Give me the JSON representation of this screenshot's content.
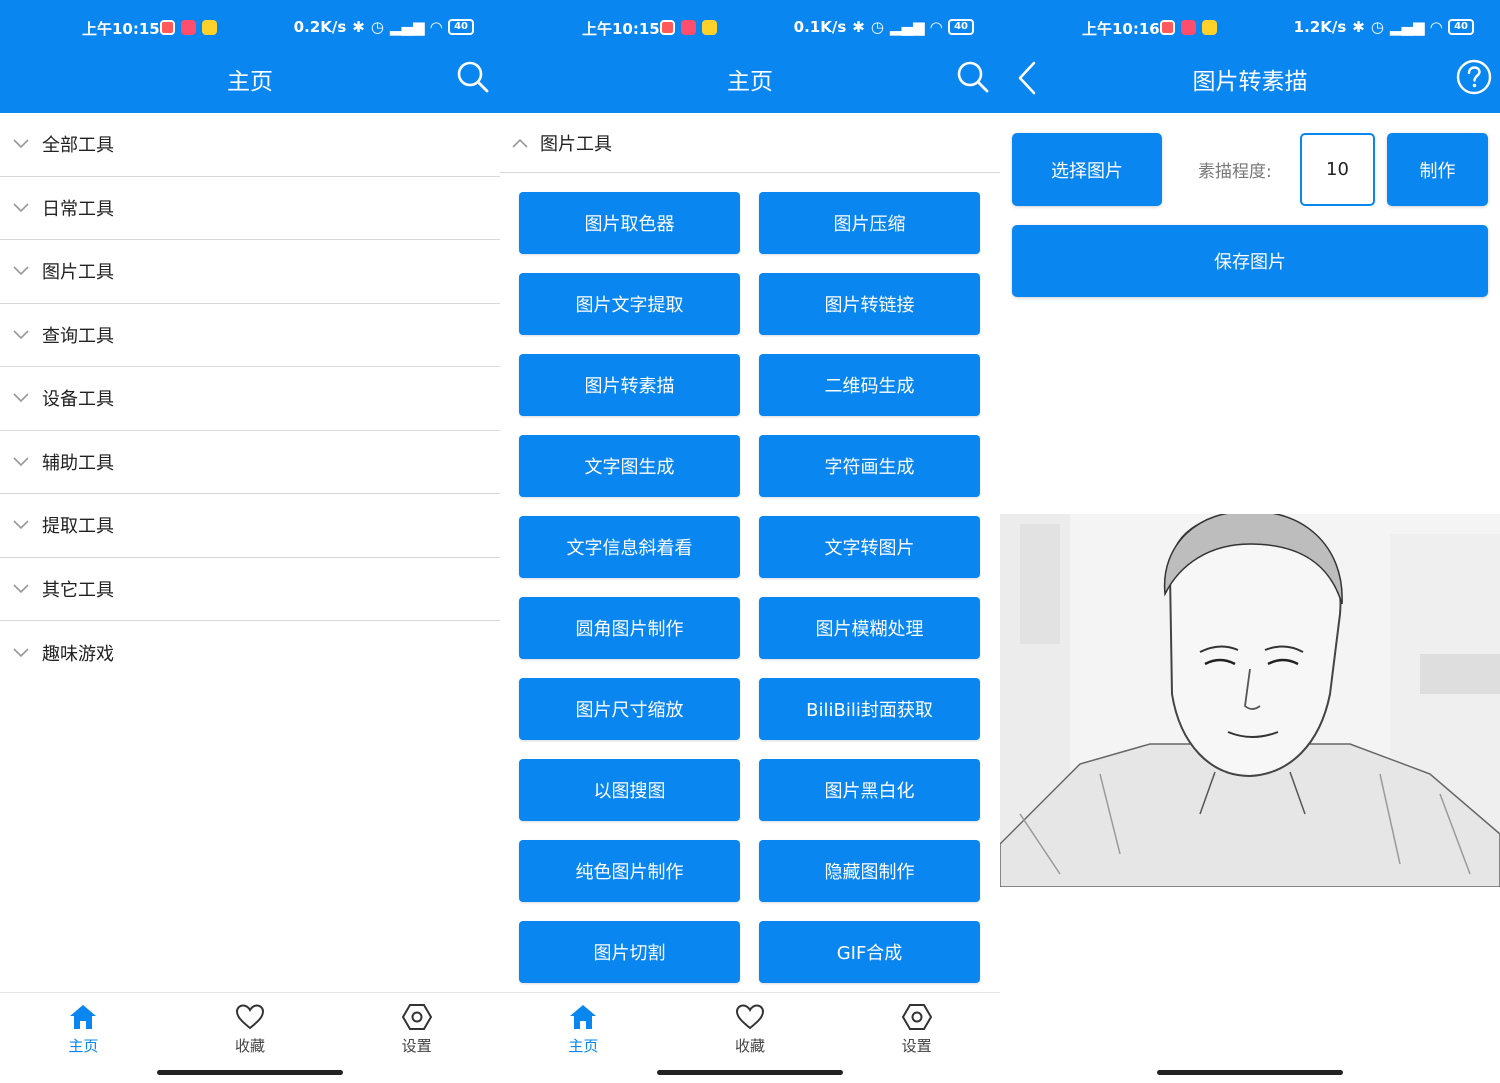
{
  "colors": {
    "primary": "#0a86f0",
    "divider": "#d8d8d8"
  },
  "screens": [
    {
      "status": {
        "time": "上午10:15",
        "speed": "0.2K/s",
        "battery": "40"
      },
      "title": "主页",
      "categories": [
        "全部工具",
        "日常工具",
        "图片工具",
        "查询工具",
        "设备工具",
        "辅助工具",
        "提取工具",
        "其它工具",
        "趣味游戏"
      ],
      "nav": [
        "主页",
        "收藏",
        "设置"
      ]
    },
    {
      "status": {
        "time": "上午10:15",
        "speed": "0.1K/s",
        "battery": "40"
      },
      "title": "主页",
      "section": "图片工具",
      "tools": [
        "图片取色器",
        "图片压缩",
        "图片文字提取",
        "图片转链接",
        "图片转素描",
        "二维码生成",
        "文字图生成",
        "字符画生成",
        "文字信息斜着看",
        "文字转图片",
        "圆角图片制作",
        "图片模糊处理",
        "图片尺寸缩放",
        "BiliBili封面获取",
        "以图搜图",
        "图片黑白化",
        "纯色图片制作",
        "隐藏图制作",
        "图片切割",
        "GIF合成"
      ],
      "nav": [
        "主页",
        "收藏",
        "设置"
      ]
    },
    {
      "status": {
        "time": "上午10:16",
        "speed": "1.2K/s",
        "battery": "40"
      },
      "title": "图片转素描",
      "select_label": "选择图片",
      "sketch_label": "素描程度:",
      "sketch_value": "10",
      "make_label": "制作",
      "save_label": "保存图片"
    }
  ]
}
